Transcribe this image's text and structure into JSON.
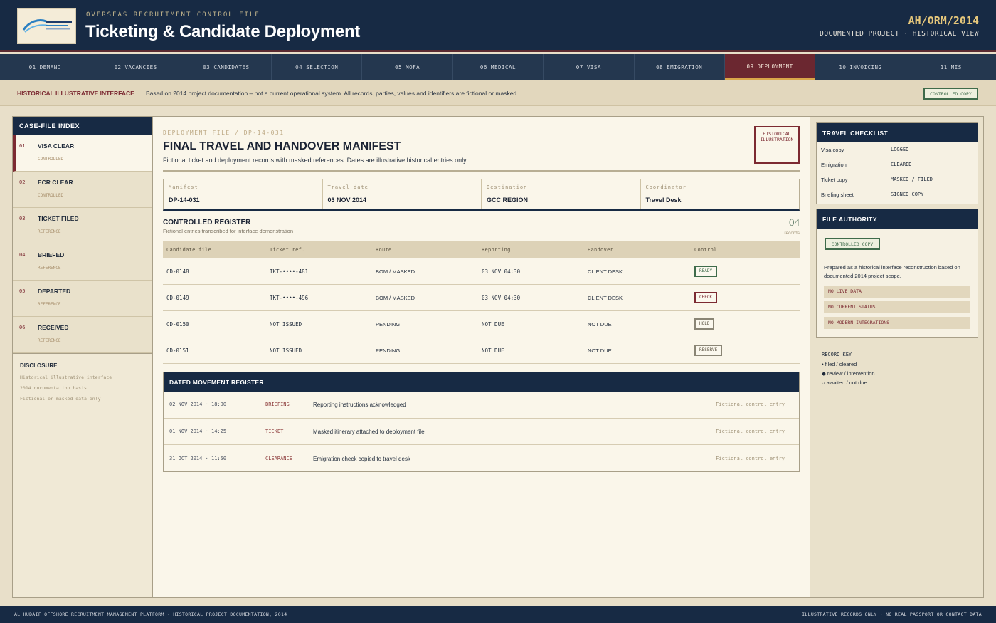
{
  "header": {
    "logo_text": "AL HUDAIF HR CONSULTANCY",
    "subtitle": "OVERSEAS RECRUITMENT CONTROL FILE",
    "title": "Ticketing & Candidate Deployment",
    "code": "AH/ORM/2014",
    "view": "DOCUMENTED PROJECT · HISTORICAL VIEW"
  },
  "nav": [
    {
      "label": "01 DEMAND"
    },
    {
      "label": "02 VACANCIES"
    },
    {
      "label": "03 CANDIDATES"
    },
    {
      "label": "04 SELECTION"
    },
    {
      "label": "05 MOFA"
    },
    {
      "label": "06 MEDICAL"
    },
    {
      "label": "07 VISA"
    },
    {
      "label": "08 EMIGRATION"
    },
    {
      "label": "09 DEPLOYMENT"
    },
    {
      "label": "10 INVOICING"
    },
    {
      "label": "11 MIS"
    }
  ],
  "notice": {
    "label": "HISTORICAL ILLUSTRATIVE INTERFACE",
    "text": "Based on 2014 project documentation – not a current operational system. All records, parties, values and identifiers are fictional or masked.",
    "badge": "CONTROLLED COPY"
  },
  "sidebar": {
    "title": "CASE-FILE INDEX",
    "items": [
      {
        "num": "01",
        "name": "VISA CLEAR",
        "state": "CONTROLLED"
      },
      {
        "num": "02",
        "name": "ECR CLEAR",
        "state": "CONTROLLED"
      },
      {
        "num": "03",
        "name": "TICKET FILED",
        "state": "REFERENCE"
      },
      {
        "num": "04",
        "name": "BRIEFED",
        "state": "REFERENCE"
      },
      {
        "num": "05",
        "name": "DEPARTED",
        "state": "REFERENCE"
      },
      {
        "num": "06",
        "name": "RECEIVED",
        "state": "REFERENCE"
      }
    ],
    "disclosure": {
      "title": "DISCLOSURE",
      "lines": [
        "Historical illustrative interface",
        "2014 documentation basis",
        "Fictional or masked data only"
      ]
    }
  },
  "file": {
    "kicker": "DEPLOYMENT FILE / DP-14-031",
    "title": "FINAL TRAVEL AND HANDOVER MANIFEST",
    "description": "Fictional ticket and deployment records with masked references. Dates are illustrative historical entries only.",
    "stamp_line1": "HISTORICAL",
    "stamp_line2": "ILLUSTRATION",
    "meta": [
      {
        "key": "Manifest",
        "value": "DP-14-031"
      },
      {
        "key": "Travel date",
        "value": "03 NOV 2014"
      },
      {
        "key": "Destination",
        "value": "GCC REGION"
      },
      {
        "key": "Coordinator",
        "value": "Travel Desk"
      }
    ]
  },
  "register": {
    "title": "CONTROLLED REGISTER",
    "subtitle": "Fictional entries transcribed for interface demonstration",
    "count": "04",
    "count_label": "records",
    "columns": [
      "Candidate file",
      "Ticket ref.",
      "Route",
      "Reporting",
      "Handover",
      "Control"
    ],
    "rows": [
      {
        "file": "CD-0148",
        "ticket": "TKT-••••-481",
        "route": "BOM / MASKED",
        "reporting": "03 NOV 04:30",
        "handover": "CLIENT DESK",
        "control": "READY"
      },
      {
        "file": "CD-0149",
        "ticket": "TKT-••••-496",
        "route": "BOM / MASKED",
        "reporting": "03 NOV 04:30",
        "handover": "CLIENT DESK",
        "control": "CHECK"
      },
      {
        "file": "CD-0150",
        "ticket": "NOT ISSUED",
        "route": "PENDING",
        "reporting": "NOT DUE",
        "handover": "NOT DUE",
        "control": "HOLD"
      },
      {
        "file": "CD-0151",
        "ticket": "NOT ISSUED",
        "route": "PENDING",
        "reporting": "NOT DUE",
        "handover": "NOT DUE",
        "control": "RESERVE"
      }
    ]
  },
  "movement": {
    "title": "DATED MOVEMENT REGISTER",
    "rows": [
      {
        "when": "02 NOV 2014 · 18:00",
        "type": "BRIEFING",
        "desc": "Reporting instructions acknowledged",
        "note": "Fictional control entry"
      },
      {
        "when": "01 NOV 2014 · 14:25",
        "type": "TICKET",
        "desc": "Masked itinerary attached to deployment file",
        "note": "Fictional control entry"
      },
      {
        "when": "31 OCT 2014 · 11:50",
        "type": "CLEARANCE",
        "desc": "Emigration check copied to travel desk",
        "note": "Fictional control entry"
      }
    ]
  },
  "checklist": {
    "title": "TRAVEL CHECKLIST",
    "items": [
      {
        "key": "Visa copy",
        "value": "LOGGED"
      },
      {
        "key": "Emigration",
        "value": "CLEARED"
      },
      {
        "key": "Ticket copy",
        "value": "MASKED / FILED"
      },
      {
        "key": "Briefing sheet",
        "value": "SIGNED COPY"
      }
    ]
  },
  "authority": {
    "title": "FILE AUTHORITY",
    "badge": "CONTROLLED COPY",
    "text": "Prepared as a historical interface reconstruction based on documented 2014 project scope.",
    "flags": [
      "NO LIVE DATA",
      "NO CURRENT STATUS",
      "NO MODERN INTEGRATIONS"
    ]
  },
  "record_key": {
    "title": "RECORD KEY",
    "items": [
      "• filed / cleared",
      "◆ review / intervention",
      "○ awaited / not due"
    ]
  },
  "footer": {
    "left": "AL HUDAIF OFFSHORE RECRUITMENT MANAGEMENT PLATFORM · HISTORICAL PROJECT DOCUMENTATION, 2014",
    "right": "ILLUSTRATIVE RECORDS ONLY · NO REAL PASSPORT OR CONTACT DATA"
  },
  "colors": {
    "navy": "#172a44",
    "maroon": "#7c2a32",
    "green": "#3f6b4a",
    "gold": "#e6c77b",
    "parchment": "#faf6ea"
  }
}
